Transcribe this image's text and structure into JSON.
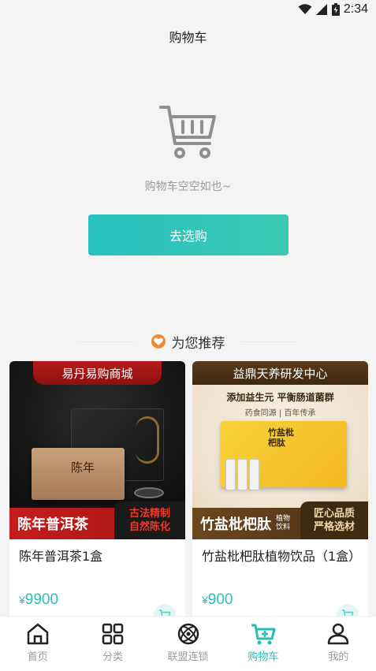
{
  "status_bar": {
    "time": "2:34"
  },
  "header": {
    "title": "购物车"
  },
  "empty_state": {
    "message": "购物车空空如也~",
    "button_label": "去选购"
  },
  "recommend": {
    "title": "为您推荐"
  },
  "products": [
    {
      "ribbon": "易丹易购商城",
      "banner_title": "陈年普洱茶",
      "badge_line1": "古法精制",
      "badge_line2": "自然陈化",
      "box_text": "陈年",
      "name": "陈年普洱茶1盒",
      "currency": "¥",
      "price": "9900"
    },
    {
      "ribbon": "益鼎天养研发中心",
      "tagline": "添加益生元  平衡肠道菌群",
      "tagline_sub": "药食同源 | 百年传承",
      "banner_title": "竹盐枇杷肽",
      "banner_small_1": "植物",
      "banner_small_2": "饮料",
      "badge_line1": "匠心品质",
      "badge_line2": "严格选材",
      "box_text": "竹盐枇杷肽",
      "name": "竹盐枇杷肽植物饮品（1盒）",
      "currency": "¥",
      "price": "900"
    }
  ],
  "tabs": [
    {
      "label": "首页",
      "icon": "home-icon",
      "active": false
    },
    {
      "label": "分类",
      "icon": "category-grid-icon",
      "active": false
    },
    {
      "label": "联盟连锁",
      "icon": "alliance-icon",
      "active": false
    },
    {
      "label": "购物车",
      "icon": "cart-icon",
      "active": true
    },
    {
      "label": "我的",
      "icon": "profile-icon",
      "active": false
    }
  ],
  "colors": {
    "accent": "#27bdb5",
    "price": "#2bc0b4",
    "heart": "#f08a3a"
  }
}
